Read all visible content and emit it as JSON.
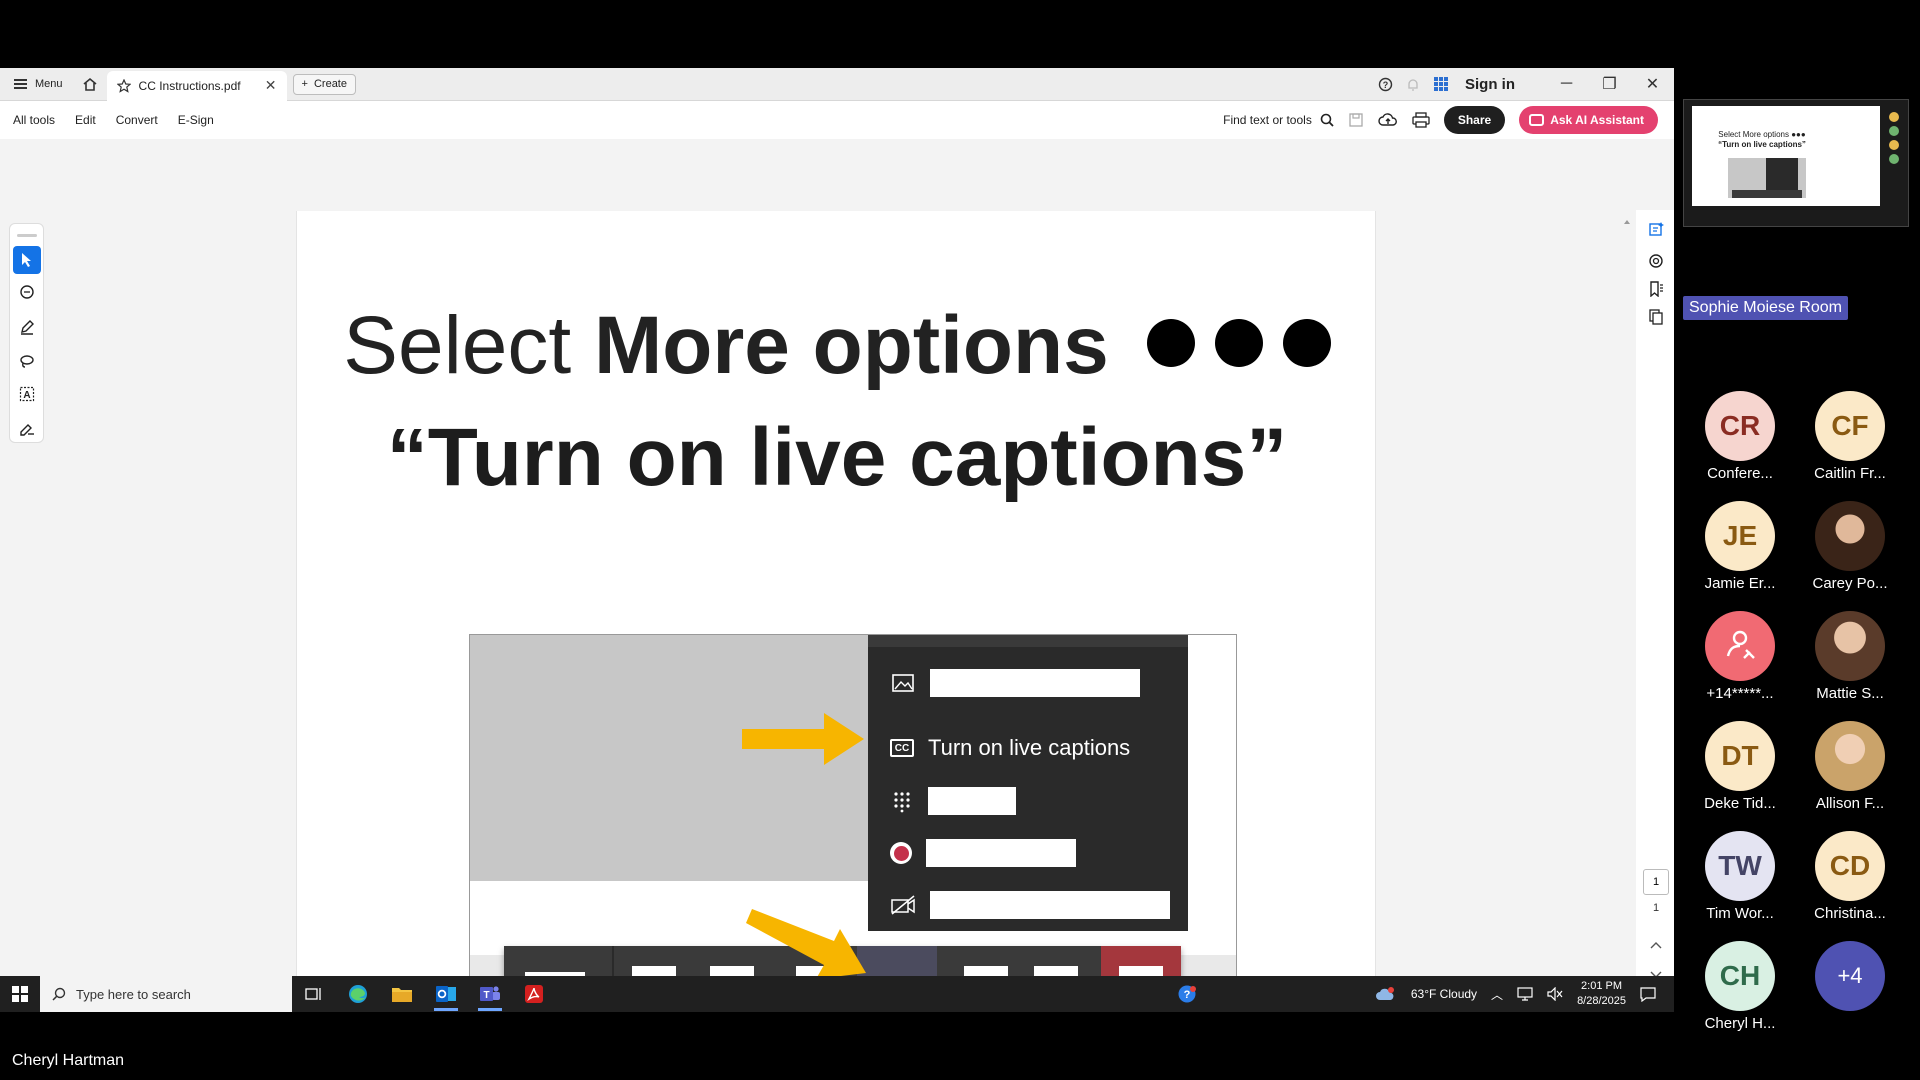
{
  "acrobat": {
    "menu_label": "Menu",
    "tab_title": "CC Instructions.pdf",
    "create_label": "Create",
    "sign_in": "Sign in",
    "toolbar": {
      "all_tools": "All tools",
      "edit": "Edit",
      "convert": "Convert",
      "esign": "E-Sign",
      "find_placeholder": "Find text or tools",
      "share": "Share",
      "ai_assistant": "Ask AI Assistant"
    },
    "page_number": "1",
    "page_total": "1"
  },
  "slide": {
    "line1_prefix": "Select",
    "line1_bold": "More options",
    "line2": "“Turn on live captions”",
    "menu_caption_item": "Turn on live captions",
    "accent_arrow_color": "#f7b500",
    "leave_color": "#a4373d",
    "record_color": "#c4314b"
  },
  "taskbar": {
    "search_placeholder": "Type here to search",
    "weather": "63°F  Cloudy",
    "time": "2:01 PM",
    "date": "8/28/2025"
  },
  "teams": {
    "thumb_line1": "Select More options ●●●",
    "thumb_line2": "“Turn on live captions”",
    "room_label": "Sophie Moiese Room",
    "participants": [
      {
        "initials": "CR",
        "name": "Confere...",
        "bg": "#f6d5cf",
        "fg": "#8a2c22"
      },
      {
        "initials": "CF",
        "name": "Caitlin Fr...",
        "bg": "#fbe9c8",
        "fg": "#8a5a12"
      },
      {
        "initials": "JE",
        "name": "Jamie Er...",
        "bg": "#fbe9c8",
        "fg": "#8a5a12"
      },
      {
        "initials": "",
        "name": "Carey Po...",
        "photo": "dark"
      },
      {
        "initials": "",
        "name": "+14*****...",
        "bg": "#f16a73",
        "fg": "#ffffff",
        "icon": "phone-person-icon"
      },
      {
        "initials": "",
        "name": "Mattie S...",
        "photo": "brown"
      },
      {
        "initials": "DT",
        "name": "Deke Tid...",
        "bg": "#fbe9c8",
        "fg": "#8a5a12"
      },
      {
        "initials": "",
        "name": "Allison F...",
        "photo": "blond"
      },
      {
        "initials": "TW",
        "name": "Tim Wor...",
        "bg": "#e4e4f2",
        "fg": "#444466"
      },
      {
        "initials": "CD",
        "name": "Christina...",
        "bg": "#fbe9c8",
        "fg": "#8a5a12"
      },
      {
        "initials": "CH",
        "name": "Cheryl H...",
        "bg": "#d9f0e3",
        "fg": "#2f6b4b"
      },
      {
        "initials": "+4",
        "name": "",
        "bg": "#4f52b2",
        "fg": "#ffffff"
      }
    ],
    "presenter_name": "Cheryl Hartman"
  }
}
